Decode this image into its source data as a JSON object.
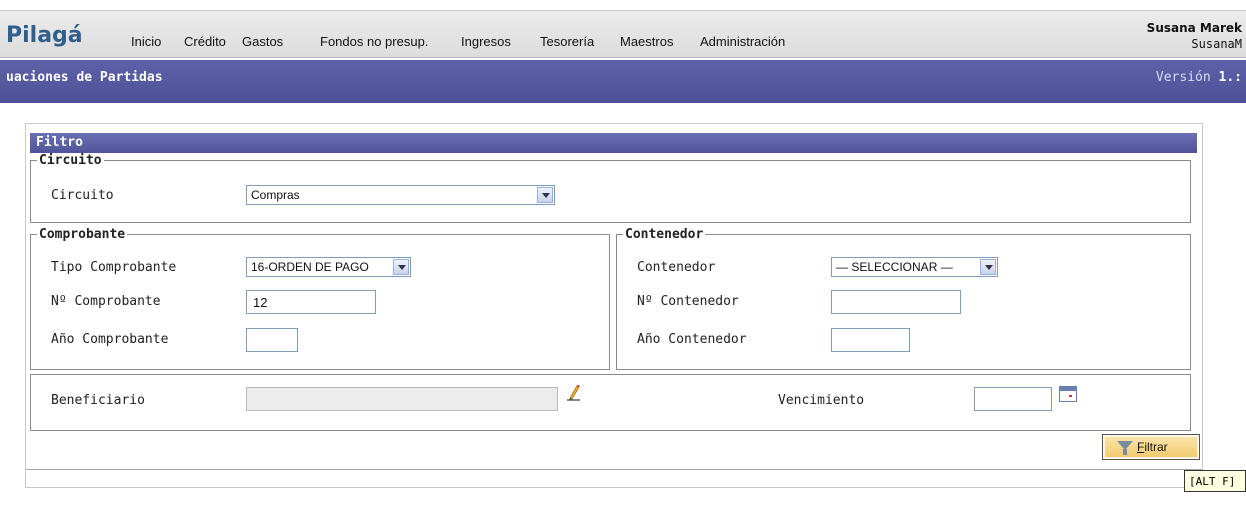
{
  "app": {
    "logo": "Pilagá"
  },
  "menu": {
    "items": [
      "Inicio",
      "Crédito",
      "Gastos",
      "Fondos no presup.",
      "Ingresos",
      "Tesorería",
      "Maestros",
      "Administración"
    ]
  },
  "user": {
    "name": "Susana Marek",
    "login": "SusanaM"
  },
  "titlebar": {
    "title": "uaciones de Partidas",
    "version_prefix": "Versión",
    "version_value": "1.:"
  },
  "filtro": {
    "header": "Filtro",
    "circuito": {
      "legend": "Circuito",
      "label": "Circuito",
      "value": "Compras"
    },
    "comprobante": {
      "legend": "Comprobante",
      "tipo_label": "Tipo Comprobante",
      "tipo_value": "16-ORDEN DE PAGO",
      "numero_label": "Nº Comprobante",
      "numero_value": "12",
      "anio_label": "Año Comprobante",
      "anio_value": ""
    },
    "contenedor": {
      "legend": "Contenedor",
      "contenedor_label": "Contenedor",
      "contenedor_value": "— SELECCIONAR —",
      "numero_label": "Nº Contenedor",
      "numero_value": "",
      "anio_label": "Año Contenedor",
      "anio_value": ""
    },
    "beneficiario": {
      "label": "Beneficiario",
      "value": ""
    },
    "vencimiento": {
      "label": "Vencimiento",
      "value": ""
    },
    "button": {
      "accesskey": "F",
      "rest": "iltrar"
    },
    "tooltip": "[ALT F]"
  }
}
